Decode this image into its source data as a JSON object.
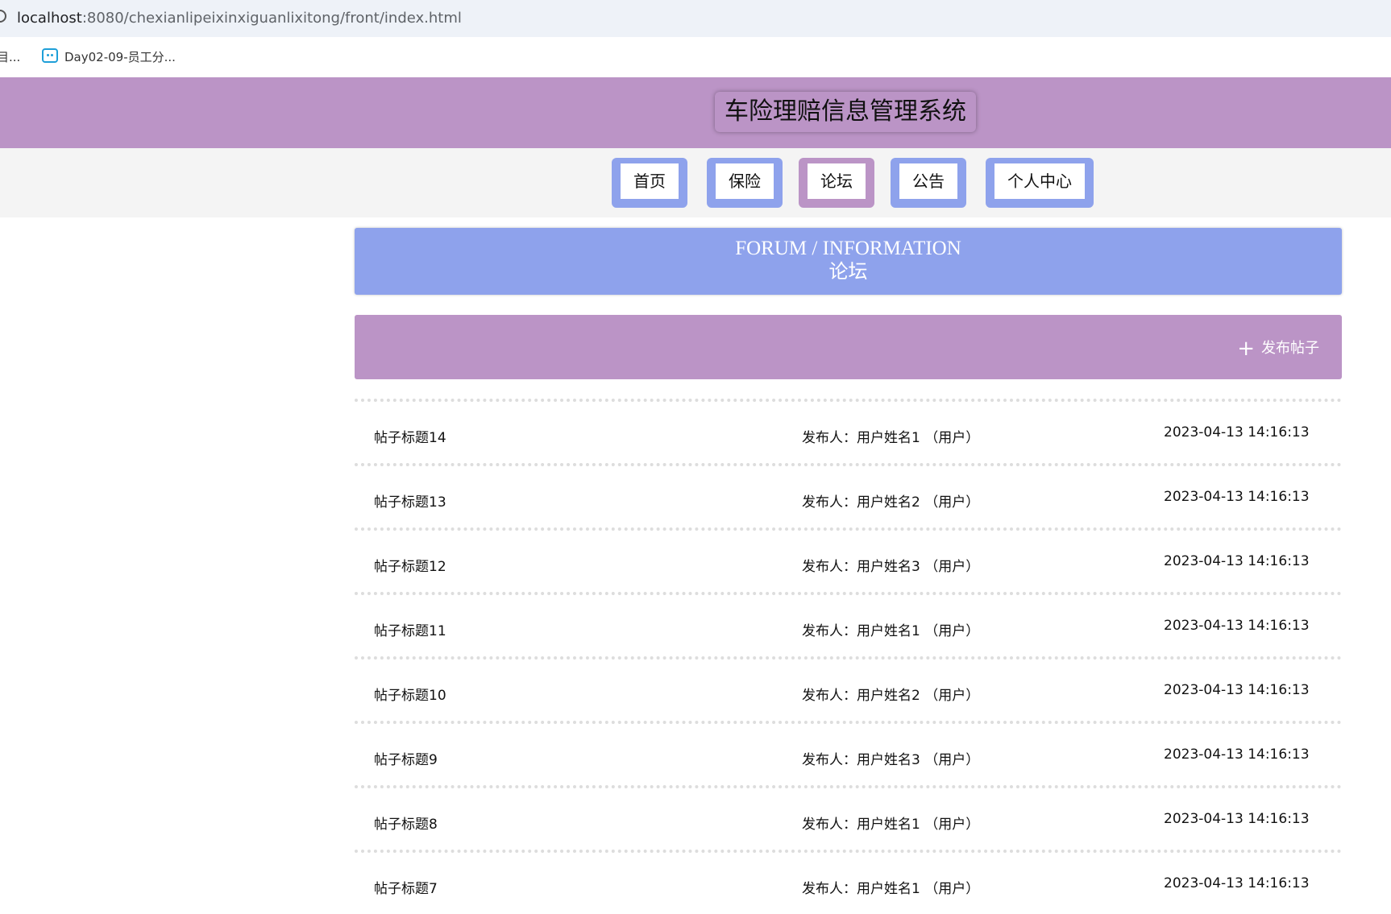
{
  "browser": {
    "url_host": "localhost",
    "url_path": ":8080/chexianlipeixinxiguanlixitong/front/index.html",
    "bookmark_partial": "目...",
    "bookmark_label": "Day02-09-员工分..."
  },
  "header": {
    "title": "车险理赔信息管理系统"
  },
  "nav": {
    "items": [
      {
        "label": "首页",
        "active": false
      },
      {
        "label": "保险",
        "active": false
      },
      {
        "label": "论坛",
        "active": true
      },
      {
        "label": "公告",
        "active": false
      },
      {
        "label": "个人中心",
        "active": false
      }
    ]
  },
  "banner": {
    "en": "FORUM / INFORMATION",
    "zh": "论坛"
  },
  "actions": {
    "publish_icon": "plus-icon",
    "publish_label": "发布帖子"
  },
  "posts": [
    {
      "title": "帖子标题14",
      "author": "发布人：用户姓名1 （用户）",
      "time": "2023-04-13 14:16:13"
    },
    {
      "title": "帖子标题13",
      "author": "发布人：用户姓名2 （用户）",
      "time": "2023-04-13 14:16:13"
    },
    {
      "title": "帖子标题12",
      "author": "发布人：用户姓名3 （用户）",
      "time": "2023-04-13 14:16:13"
    },
    {
      "title": "帖子标题11",
      "author": "发布人：用户姓名1 （用户）",
      "time": "2023-04-13 14:16:13"
    },
    {
      "title": "帖子标题10",
      "author": "发布人：用户姓名2 （用户）",
      "time": "2023-04-13 14:16:13"
    },
    {
      "title": "帖子标题9",
      "author": "发布人：用户姓名3 （用户）",
      "time": "2023-04-13 14:16:13"
    },
    {
      "title": "帖子标题8",
      "author": "发布人：用户姓名1 （用户）",
      "time": "2023-04-13 14:16:13"
    },
    {
      "title": "帖子标题7",
      "author": "发布人：用户姓名1 （用户）",
      "time": "2023-04-13 14:16:13"
    }
  ],
  "colors": {
    "purple": "#bb94c6",
    "blue": "#8ea2ec",
    "nav_strip": "#f4f4f4"
  }
}
